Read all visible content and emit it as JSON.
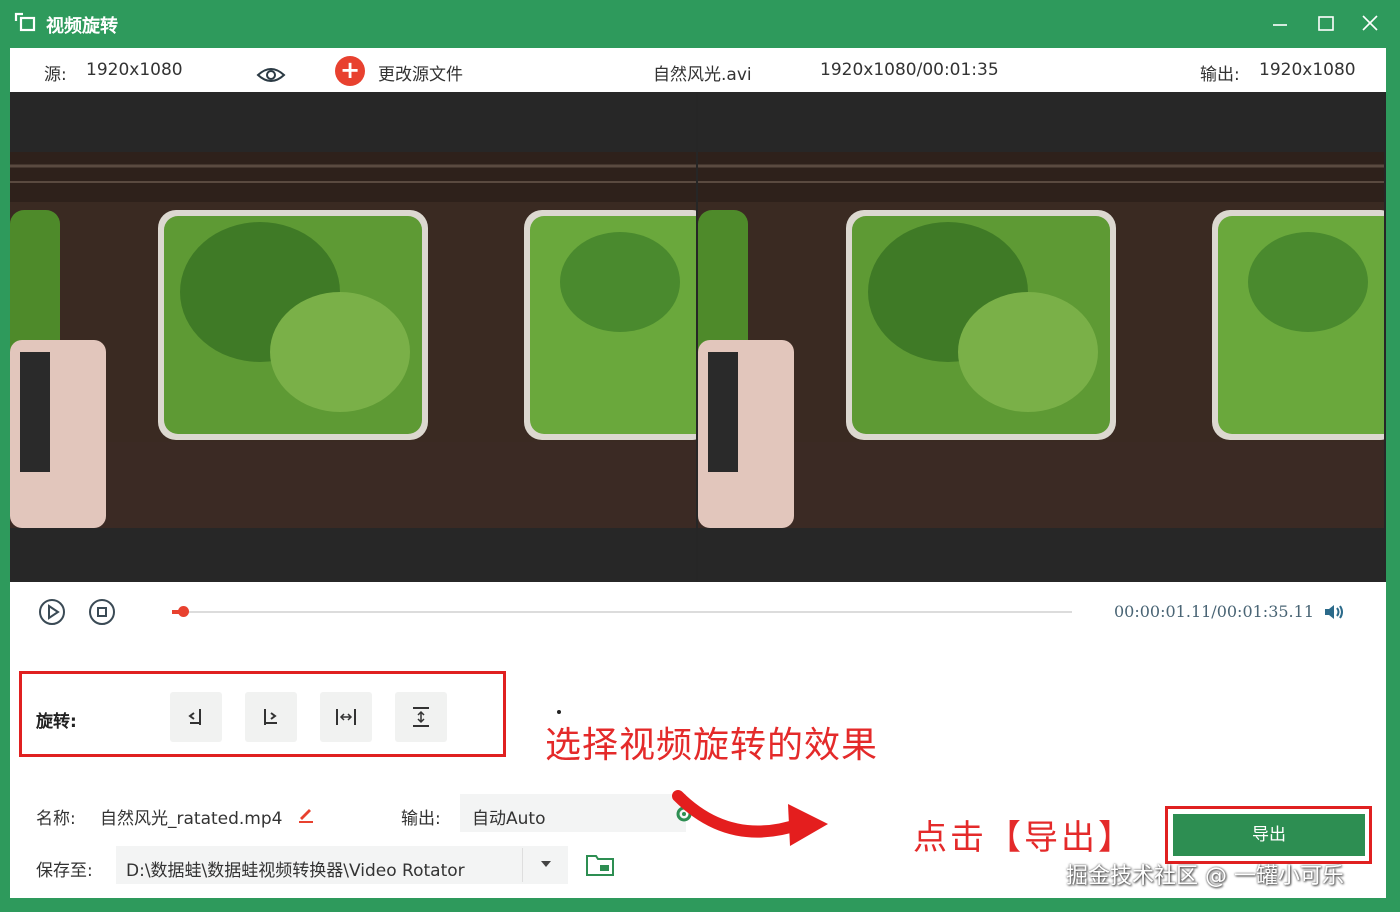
{
  "window": {
    "title": "视频旋转"
  },
  "info": {
    "source_label": "源:",
    "source_res": "1920x1080",
    "change_source": "更改源文件",
    "filename": "自然风光.avi",
    "file_meta": "1920x1080/00:01:35",
    "output_label": "输出:",
    "output_res": "1920x1080"
  },
  "player": {
    "time": "00:00:01.11/00:01:35.11",
    "progress_percent": 1.2
  },
  "rotate": {
    "label": "旋转:",
    "buttons": [
      "rotate-left",
      "rotate-right",
      "flip-horizontal",
      "flip-vertical"
    ]
  },
  "annotations": {
    "choose_effect": "选择视频旋转的效果",
    "click_export": "点击【导出】"
  },
  "form": {
    "name_label": "名称:",
    "name_value": "自然风光_ratated.mp4",
    "output_label": "输出:",
    "output_value": "自动Auto",
    "save_label": "保存至:",
    "save_path": "D:\\数据蛙\\数据蛙视频转换器\\Video Rotator"
  },
  "export": {
    "label": "导出"
  },
  "watermark": "掘金技术社区 @ 一罐小可乐",
  "colors": {
    "brand": "#2e9a5c",
    "accent": "#e8412f",
    "annotation": "#e42a2a"
  }
}
